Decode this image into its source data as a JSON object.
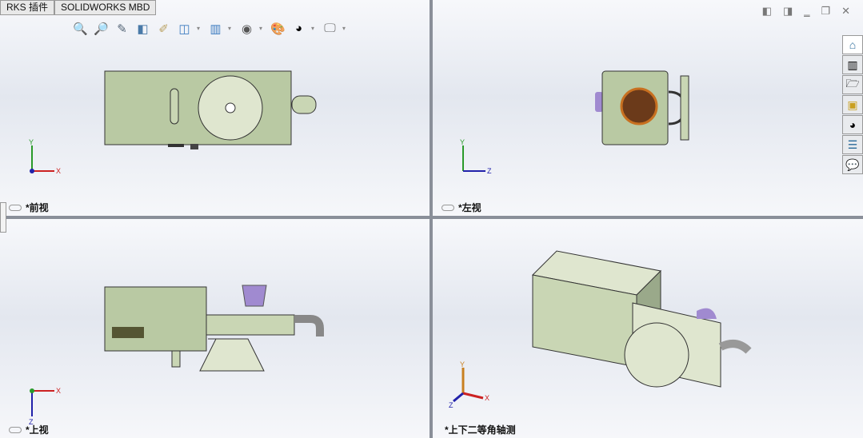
{
  "tabs": [
    {
      "label": "RKS 插件"
    },
    {
      "label": "SOLIDWORKS MBD"
    }
  ],
  "toolbar": {
    "icons": [
      "zoom-to-fit-icon",
      "zoom-to-area-icon",
      "previous-view-icon",
      "section-view-icon",
      "dynamic-annotation-icon",
      "view-orientation-icon",
      "display-style-icon",
      "hide-show-items-icon",
      "edit-appearance-icon",
      "apply-scene-icon",
      "view-settings-icon"
    ]
  },
  "window_controls": [
    "prev-icon",
    "next-icon",
    "minimize-icon",
    "restore-icon",
    "close-icon"
  ],
  "task_pane": [
    "home-icon",
    "design-library-icon",
    "file-explorer-icon",
    "view-palette-icon",
    "appearances-icon",
    "custom-properties-icon",
    "forum-icon"
  ],
  "viewports": [
    {
      "label": "*前视",
      "axes": [
        "Y",
        "X"
      ]
    },
    {
      "label": "*左视",
      "axes": [
        "Y",
        "Z"
      ]
    },
    {
      "label": "*上视",
      "axes": [
        "X",
        "Z"
      ]
    },
    {
      "label": "*上下二等角轴测",
      "axes": [
        "Y",
        "X",
        "Z"
      ]
    }
  ],
  "colors": {
    "part": "#b9c9a3",
    "edge": "#333333",
    "accent": "#9c88c8"
  }
}
